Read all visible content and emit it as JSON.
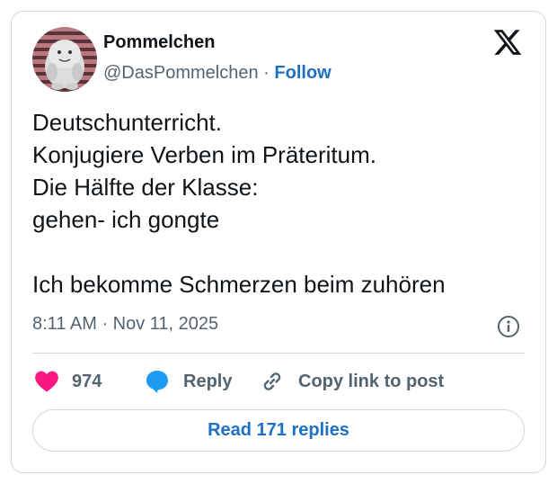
{
  "author": {
    "display_name": "Pommelchen",
    "handle": "@DasPommelchen",
    "separator": "·",
    "follow_label": "Follow"
  },
  "tweet": {
    "lines": [
      "Deutschunterricht.",
      "Konjugiere Verben im Präteritum.",
      "Die Hälfte der Klasse:",
      "gehen- ich gongte",
      "",
      "Ich bekomme Schmerzen beim zuhören"
    ],
    "timestamp": "8:11 AM · Nov 11, 2025"
  },
  "actions": {
    "like_count": "974",
    "reply_label": "Reply",
    "copy_label": "Copy link to post"
  },
  "read_replies_label": "Read 171 replies",
  "icons": {
    "brand": "x-logo-icon",
    "info": "info-icon",
    "like": "heart-icon",
    "reply": "speech-bubble-icon",
    "copy": "link-icon"
  },
  "colors": {
    "text": "#0f1419",
    "muted": "#536471",
    "link": "#1d70c4",
    "heart": "#f91880",
    "reply_bubble": "#1d9bf0",
    "border": "#cfd9de"
  }
}
